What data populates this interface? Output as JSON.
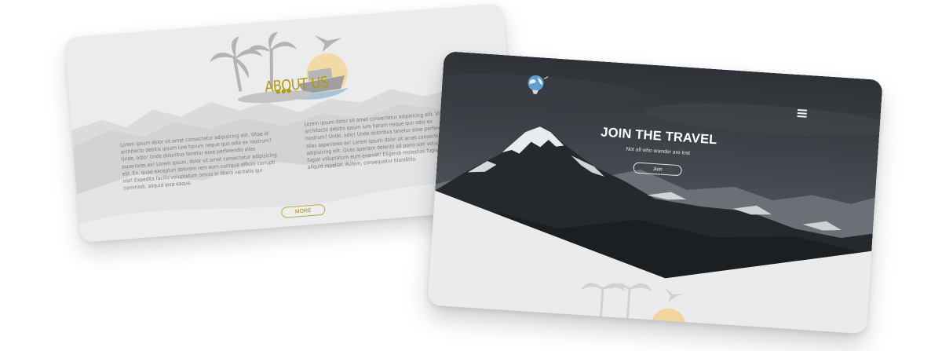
{
  "about_card": {
    "title": "ABOUT US",
    "left_text": "Lorem ipsum dolor sit amet consectetur adipisicing elit. Vitae id architecto debitis ipsum iure harum neque quo odio ex nostrum? Unde, odio! Unde doloribus tenetur esse perferendis alias asperiores ex! Lorem ipsum, dolor sit amet consectetur adipisicing elit. Ex, quae excepturi dolorem rem eum cumque officiis corrupti nisi! Expedita facilis voluptatum omnis in libero veritatis qui commodi, aliquid ipsa eaque.",
    "right_text": "Lorem ipsum dolor sit amet consectetur adipisicing elit. Vitae id architecto debitis ipsum iure harum neque quo odio ex nostrum? Unde, odio! Unde doloribus tenetur esse perferendis alias asperiores ex! Lorem ipsum dolor sit amet consectetur adipisicing elit. Quas aperiam deleniti ad porro sint voluptates, fugiat voluptatum eum eveniet! Eligendi molestias fugiat fuga aliquid repellat. Autem, consequatur blanditiis.",
    "more_label": "MORE",
    "accent_color": "#b09a12"
  },
  "hero_card": {
    "title": "JOIN THE TRAVEL",
    "subtitle": "Not all who wander are lost",
    "join_label": "Join",
    "logo_icon": "globe-balloon-icon",
    "menu_icon": "hamburger-menu-icon"
  }
}
